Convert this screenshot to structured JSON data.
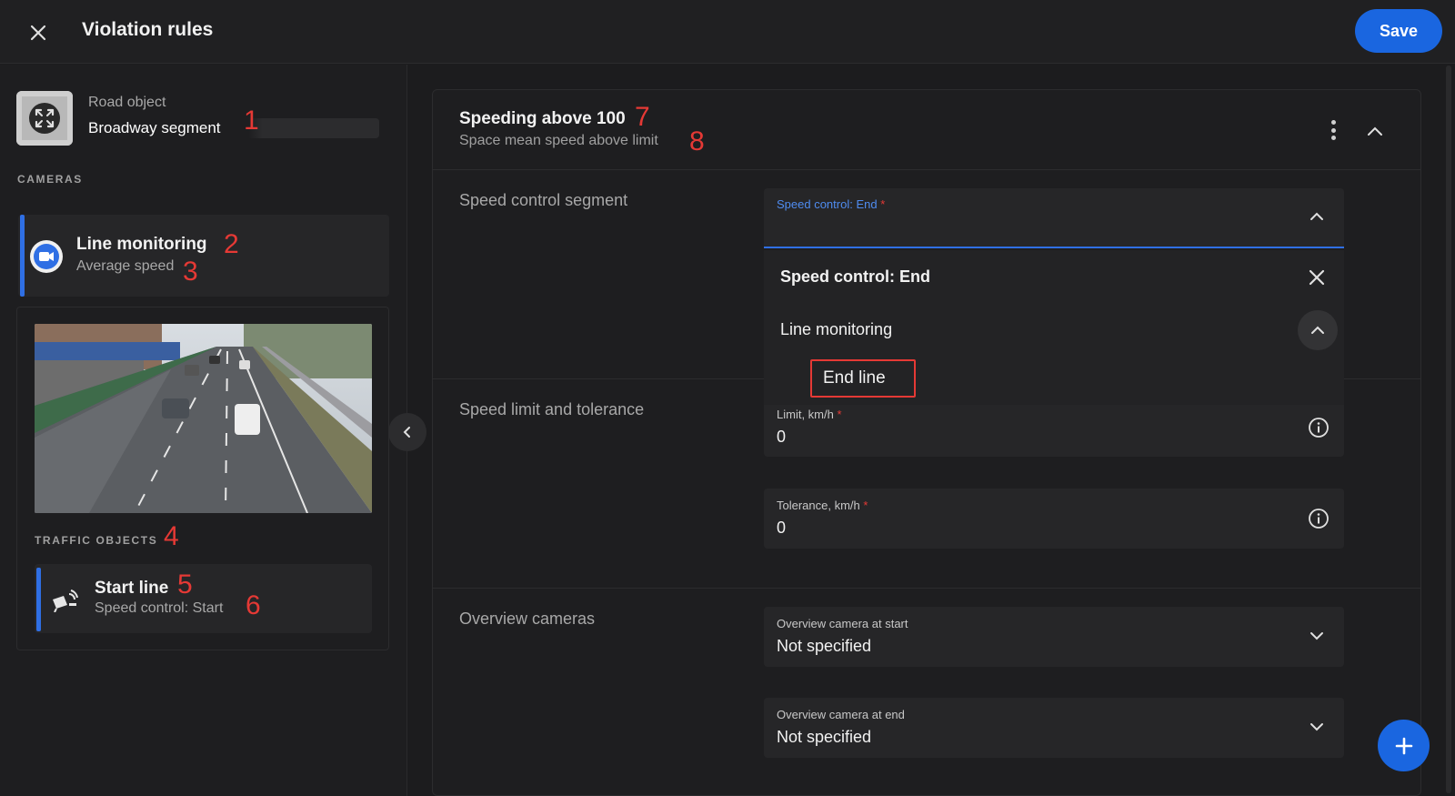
{
  "header": {
    "title": "Violation rules",
    "save_label": "Save"
  },
  "sidebar": {
    "road_object_label": "Road object",
    "road_object_value": "Broadway segment",
    "cameras_label": "CAMERAS",
    "camera": {
      "title": "Line monitoring",
      "subtitle": "Average speed"
    },
    "traffic_objects_label": "TRAFFIC OBJECTS",
    "traffic_object": {
      "title": "Start line",
      "subtitle": "Speed control: Start"
    }
  },
  "annotations": [
    "1",
    "2",
    "3",
    "4",
    "5",
    "6",
    "7",
    "8"
  ],
  "rule": {
    "title": "Speeding above 100",
    "subtitle": "Space mean speed above limit",
    "sections": {
      "speed_control_segment": "Speed control segment",
      "speed_limit_tolerance": "Speed limit and tolerance",
      "overview_cameras": "Overview cameras"
    },
    "speed_control_field": {
      "label": "Speed control: End",
      "required": "*"
    },
    "dropdown": {
      "selected": "Speed control: End",
      "group": "Line monitoring",
      "option": "End line"
    },
    "limit_field": {
      "label": "Limit, km/h",
      "required": "*",
      "value": "0"
    },
    "tolerance_field": {
      "label": "Tolerance, km/h",
      "required": "*",
      "value": "0"
    },
    "overview_start": {
      "label": "Overview camera at start",
      "value": "Not specified"
    },
    "overview_end": {
      "label": "Overview camera at end",
      "value": "Not specified"
    }
  },
  "colors": {
    "accent": "#1a66e0",
    "annotation": "#e53935",
    "background": "#1c1c1e"
  },
  "icons": [
    "close-icon",
    "road-object-icon",
    "camera-icon",
    "line-sensor-icon",
    "chevron-left-icon",
    "kebab-menu-icon",
    "chevron-up-icon",
    "info-icon",
    "chevron-down-icon",
    "plus-icon"
  ]
}
